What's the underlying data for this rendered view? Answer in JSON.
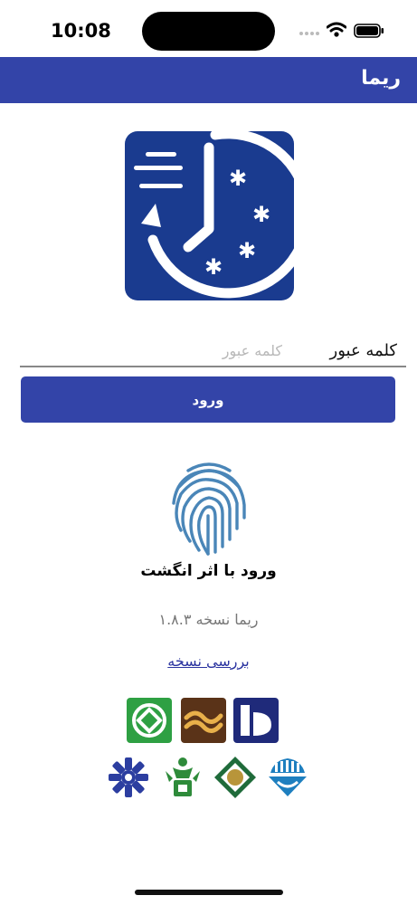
{
  "status_bar": {
    "time": "10:08"
  },
  "app_bar": {
    "title": "ریما"
  },
  "login": {
    "password_label": "کلمه عبور",
    "password_placeholder": "کلمه عبور",
    "submit_label": "ورود"
  },
  "fingerprint": {
    "label": "ورود با اثر انگشت"
  },
  "version": {
    "text": "ریما نسخه ۱.۸.۳",
    "check_link": "بررسی نسخه"
  },
  "colors": {
    "primary": "#3344a8",
    "link": "#2b34a0",
    "logo_bg": "#1a3b8f",
    "fingerprint": "#4a86b8"
  },
  "icons": [
    "cellular-signal-icon",
    "wifi-icon",
    "battery-icon",
    "app-logo-icon",
    "fingerprint-icon",
    "bank-logo-green-icon",
    "bank-logo-brown-icon",
    "bank-logo-navy-icon",
    "bank-logo-blue-snowflake-icon",
    "bank-logo-green-figure-icon",
    "bank-logo-diamond-icon",
    "bank-logo-teal-icon"
  ]
}
